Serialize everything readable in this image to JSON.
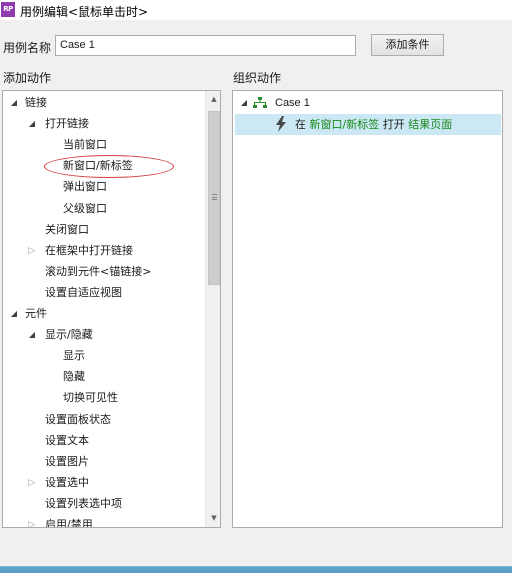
{
  "titlebar": {
    "icon_text": "RP",
    "title": "用例编辑<鼠标单击时>"
  },
  "case_name": {
    "label": "用例名称",
    "value": "Case 1",
    "add_condition_label": "添加条件"
  },
  "left_section": {
    "label": "添加动作",
    "items": [
      {
        "label": "链接",
        "level": 0,
        "state": "expanded"
      },
      {
        "label": "打开链接",
        "level": 1,
        "state": "expanded"
      },
      {
        "label": "当前窗口",
        "level": 2,
        "state": "leaf"
      },
      {
        "label": "新窗口/新标签",
        "level": 2,
        "state": "leaf"
      },
      {
        "label": "弹出窗口",
        "level": 2,
        "state": "leaf"
      },
      {
        "label": "父级窗口",
        "level": 2,
        "state": "leaf"
      },
      {
        "label": "关闭窗口",
        "level": 1,
        "state": "leaf"
      },
      {
        "label": "在框架中打开链接",
        "level": 1,
        "state": "collapsed"
      },
      {
        "label": "滚动到元件<锚链接>",
        "level": 1,
        "state": "leaf"
      },
      {
        "label": "设置自适应视图",
        "level": 1,
        "state": "leaf"
      },
      {
        "label": "元件",
        "level": 0,
        "state": "expanded"
      },
      {
        "label": "显示/隐藏",
        "level": 1,
        "state": "expanded"
      },
      {
        "label": "显示",
        "level": 2,
        "state": "leaf"
      },
      {
        "label": "隐藏",
        "level": 2,
        "state": "leaf"
      },
      {
        "label": "切换可见性",
        "level": 2,
        "state": "leaf"
      },
      {
        "label": "设置面板状态",
        "level": 1,
        "state": "leaf"
      },
      {
        "label": "设置文本",
        "level": 1,
        "state": "leaf"
      },
      {
        "label": "设置图片",
        "level": 1,
        "state": "leaf"
      },
      {
        "label": "设置选中",
        "level": 1,
        "state": "collapsed"
      },
      {
        "label": "设置列表选中项",
        "level": 1,
        "state": "leaf"
      },
      {
        "label": "启用/禁用",
        "level": 1,
        "state": "collapsed"
      }
    ]
  },
  "right_section": {
    "label": "组织动作",
    "case_label": "Case 1",
    "action": {
      "prefix": "在",
      "target": "新窗口/新标签",
      "verb": "打开",
      "page": "结果页面"
    }
  },
  "colors": {
    "accent_green": "#1a8a1a",
    "selection": "#cce8f4",
    "highlight_ellipse": "#d23b3b",
    "app_icon": "#8e3bb0"
  }
}
